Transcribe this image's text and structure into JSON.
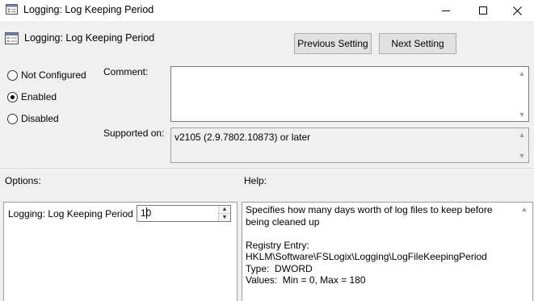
{
  "window": {
    "title": "Logging: Log Keeping Period",
    "controls": {
      "minimize_icon": "minimize-icon",
      "maximize_icon": "maximize-icon",
      "close_icon": "close-icon"
    }
  },
  "header": {
    "title": "Logging: Log Keeping Period",
    "previous_label": "Previous Setting",
    "next_label": "Next Setting"
  },
  "state": {
    "options": [
      {
        "label": "Not Configured",
        "checked": false
      },
      {
        "label": "Enabled",
        "checked": true
      },
      {
        "label": "Disabled",
        "checked": false
      }
    ]
  },
  "comment": {
    "label": "Comment:",
    "value": ""
  },
  "supported": {
    "label": "Supported on:",
    "value": "v2105 (2.9.7802.10873) or later"
  },
  "options_section": {
    "label": "Options:",
    "setting_label": "Logging: Log Keeping Period",
    "setting_value": "10"
  },
  "help_section": {
    "label": "Help:",
    "text": "Specifies how many days worth of log files to keep before being cleaned up\n\nRegistry Entry:  HKLM\\Software\\FSLogix\\Logging\\LogFileKeepingPeriod\nType:  DWORD\nValues:  Min = 0, Max = 180"
  },
  "colors": {
    "background": "#f0f0f0",
    "panel": "#ffffff",
    "button": "#e1e1e1",
    "border": "#7a7a7a"
  }
}
